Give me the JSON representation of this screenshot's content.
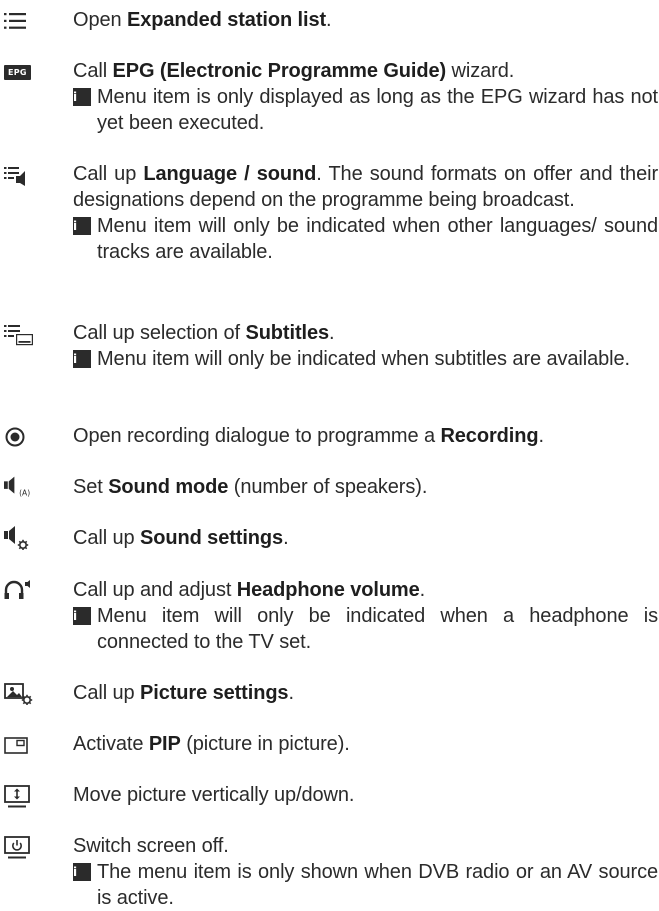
{
  "items": [
    {
      "icon": "expanded-list-icon",
      "pre": "Open ",
      "bold": "Expanded station list",
      "post": "."
    },
    {
      "icon": "epg-icon",
      "icon_text": "EPG",
      "pre": "Call ",
      "bold": "EPG (Electronic Programme Guide)",
      "post": " wizard.",
      "note": "Menu item is only displayed as long as the EPG wizard has not yet been executed."
    },
    {
      "icon": "language-sound-icon",
      "pre": "Call up ",
      "bold": "Language / sound",
      "post": ". The sound formats on offer and their designations depend on the programme being broadcast.",
      "note": "Menu item will only be indicated when other languages/ sound tracks are available."
    },
    {
      "icon": "subtitles-icon",
      "pre": "Call up selection of ",
      "bold": "Subtitles",
      "post": ".",
      "note": "Menu item will only be indicated when subtitles are available."
    },
    {
      "icon": "record-icon",
      "pre": "Open recording dialogue to programme a ",
      "bold": "Recording",
      "post": "."
    },
    {
      "icon": "sound-mode-icon",
      "icon_text": "(A)",
      "pre": "Set ",
      "bold": "Sound mode",
      "post": " (number of speakers)."
    },
    {
      "icon": "sound-settings-icon",
      "pre": "Call up ",
      "bold": "Sound settings",
      "post": "."
    },
    {
      "icon": "headphone-icon",
      "pre": "Call up and adjust ",
      "bold": "Headphone volume",
      "post": ".",
      "note": "Menu item will only be indicated when a headphone is connected to the TV set."
    },
    {
      "icon": "picture-settings-icon",
      "pre": "Call up ",
      "bold": "Picture settings",
      "post": "."
    },
    {
      "icon": "pip-icon",
      "pre": "Activate ",
      "bold": "PIP",
      "post": " (picture in picture)."
    },
    {
      "icon": "move-picture-icon",
      "pre": "",
      "bold": "",
      "post": "Move picture vertically up/down."
    },
    {
      "icon": "screen-off-icon",
      "pre": "",
      "bold": "",
      "post": "Switch screen off.",
      "note": "The menu item is only shown when DVB radio or an AV source is active."
    }
  ],
  "info_symbol": "i",
  "colors": {
    "text": "#2b2b2b",
    "icon": "#2b2b2b",
    "background": "#ffffff"
  }
}
